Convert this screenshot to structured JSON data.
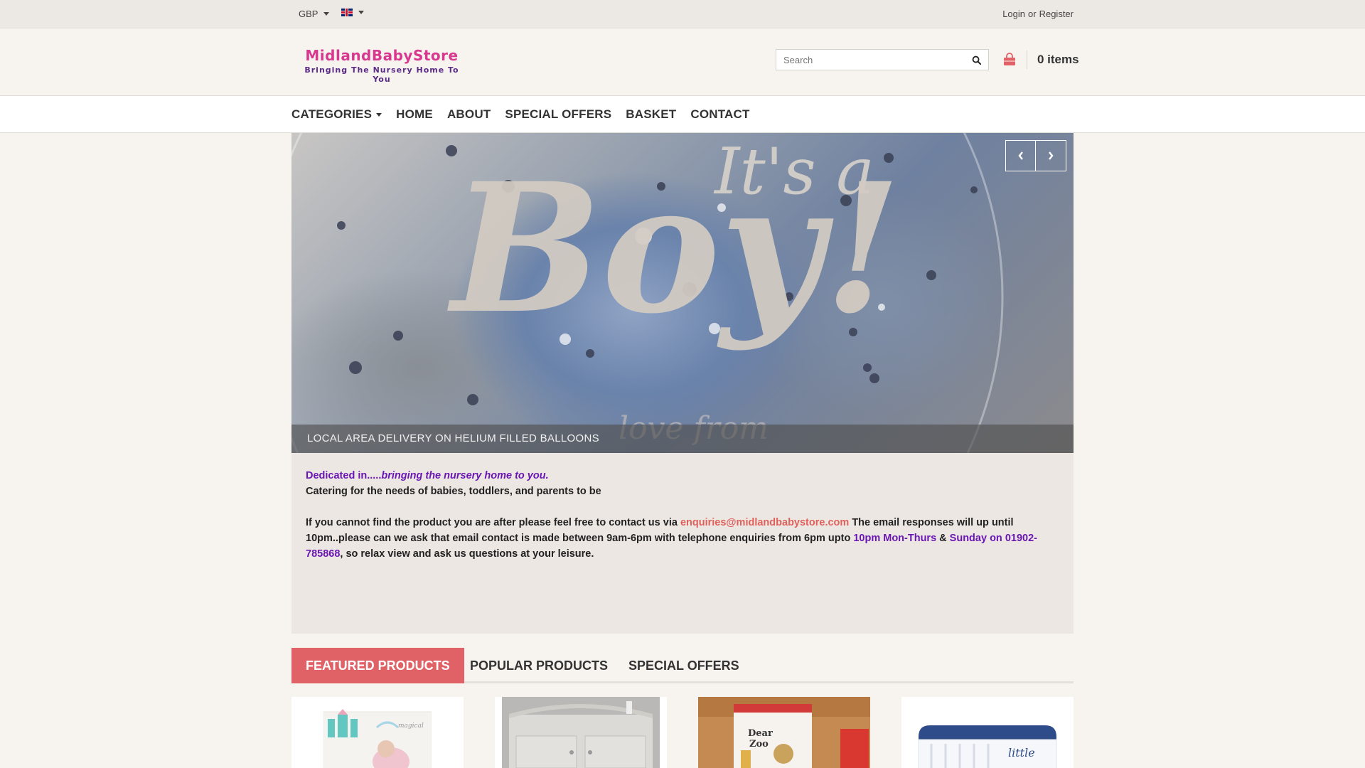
{
  "topbar": {
    "currency": "GBP",
    "language_icon": "uk-flag-icon",
    "login_label": "Login",
    "or_label": "or",
    "register_label": "Register"
  },
  "header": {
    "logo_title": "MidlandBabyStore",
    "logo_tagline": "Bringing The Nursery Home To You",
    "search_placeholder": "Search",
    "cart_count": "0 items"
  },
  "nav": {
    "items": [
      "CATEGORIES",
      "HOME",
      "ABOUT",
      "SPECIAL OFFERS",
      "BASKET",
      "CONTACT"
    ]
  },
  "slider": {
    "caption": "LOCAL AREA DELIVERY ON HELIUM FILLED BALLOONS",
    "image_text_top": "It's a",
    "image_text_main": "Boy!",
    "image_text_bottom": "love from"
  },
  "info": {
    "line1_a": "Dedicated in.....",
    "line1_b": "bringing the nursery home to you.",
    "line2": "Catering for the needs of babies, toddlers, and parents to be",
    "p2_a": "If you cannot find the product you are after please feel free to contact us via ",
    "email": "enquiries@midlandbabystore.com",
    "p2_b": " The email responses will up until 10pm..please can we ask that email contact is made between 9am-6pm with telephone enquiries from 6pm upto ",
    "hours1": "10pm Mon-Thurs",
    "amp": " & ",
    "hours2": "Sunday on 01902-785868",
    "p2_c": ", so relax view and ask us questions at your leisure."
  },
  "tabs": [
    "FEATURED PRODUCTS",
    "POPULAR PRODUCTS",
    "SPECIAL OFFERS"
  ],
  "colors": {
    "accent": "#e06166",
    "purple": "#6a16b5",
    "email": "#e0605c",
    "logo_pink": "#d8398f"
  }
}
